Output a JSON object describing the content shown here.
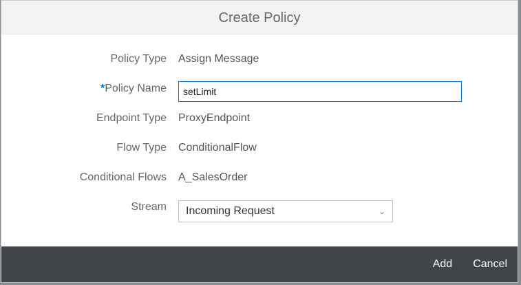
{
  "dialog": {
    "title": "Create Policy"
  },
  "form": {
    "policy_type": {
      "label": "Policy Type",
      "value": "Assign Message"
    },
    "policy_name": {
      "required_mark": "*",
      "label": "Policy Name",
      "value": "setLimit"
    },
    "endpoint_type": {
      "label": "Endpoint Type",
      "value": "ProxyEndpoint"
    },
    "flow_type": {
      "label": "Flow Type",
      "value": "ConditionalFlow"
    },
    "conditional_flows": {
      "label": "Conditional Flows",
      "value": "A_SalesOrder"
    },
    "stream": {
      "label": "Stream",
      "value": "Incoming Request"
    }
  },
  "footer": {
    "add_label": "Add",
    "cancel_label": "Cancel"
  }
}
